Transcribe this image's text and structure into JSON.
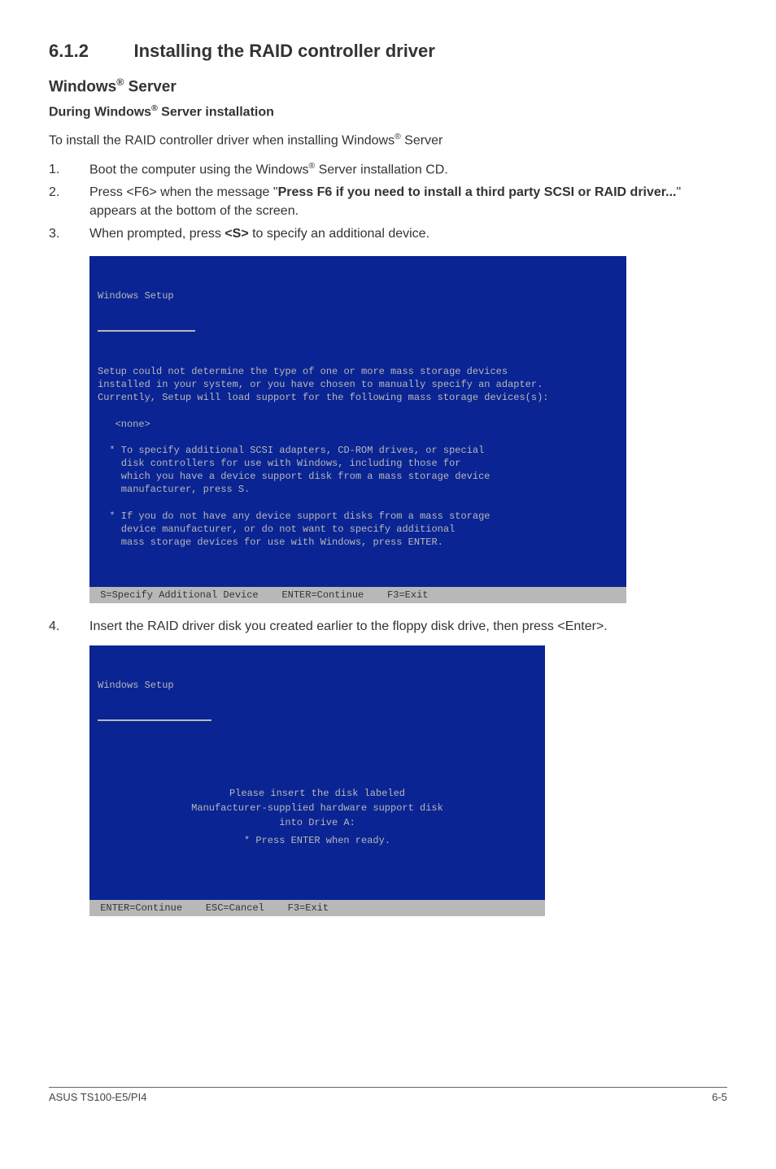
{
  "section": {
    "number": "6.1.2",
    "title": "Installing the RAID controller driver"
  },
  "sub_heading_prefix": "Windows",
  "sub_heading_suffix": " Server",
  "sub_sub_prefix": "During Windows",
  "sub_sub_suffix": " Server installation",
  "intro_prefix": "To install the RAID controller driver when installing Windows",
  "intro_suffix": " Server",
  "steps_a": [
    {
      "n": "1.",
      "pre": "Boot the computer using the Windows",
      "post": " Server installation CD."
    },
    {
      "n": "2.",
      "plain1": "Press <F6> when the message \"",
      "bold": "Press F6 if you need to install a third party SCSI or RAID driver...",
      "plain2": "\" appears at the bottom of the screen."
    },
    {
      "n": "3.",
      "plain1": "When prompted, press ",
      "bold": "<S>",
      "plain2": " to specify an additional device."
    }
  ],
  "console1": {
    "title": "Windows Setup",
    "lines": "Setup could not determine the type of one or more mass storage devices\ninstalled in your system, or you have chosen to manually specify an adapter.\nCurrently, Setup will load support for the following mass storage devices(s):\n\n   <none>\n\n  * To specify additional SCSI adapters, CD-ROM drives, or special\n    disk controllers for use with Windows, including those for\n    which you have a device support disk from a mass storage device\n    manufacturer, press S.\n\n  * If you do not have any device support disks from a mass storage\n    device manufacturer, or do not want to specify additional\n    mass storage devices for use with Windows, press ENTER.",
    "footer": " S=Specify Additional Device    ENTER=Continue    F3=Exit"
  },
  "step4": {
    "n": "4.",
    "text": "Insert the RAID driver disk you created earlier to the floppy disk drive, then press <Enter>."
  },
  "console2": {
    "title": "Windows Setup",
    "line1": "Please insert the disk labeled",
    "line2": "Manufacturer-supplied hardware support disk",
    "line3": "into Drive A:",
    "line4": "*   Press ENTER when ready.",
    "footer": " ENTER=Continue    ESC=Cancel    F3=Exit"
  },
  "footer": {
    "left": "ASUS TS100-E5/PI4",
    "right": "6-5"
  },
  "glyphs": {
    "reg": "®"
  }
}
